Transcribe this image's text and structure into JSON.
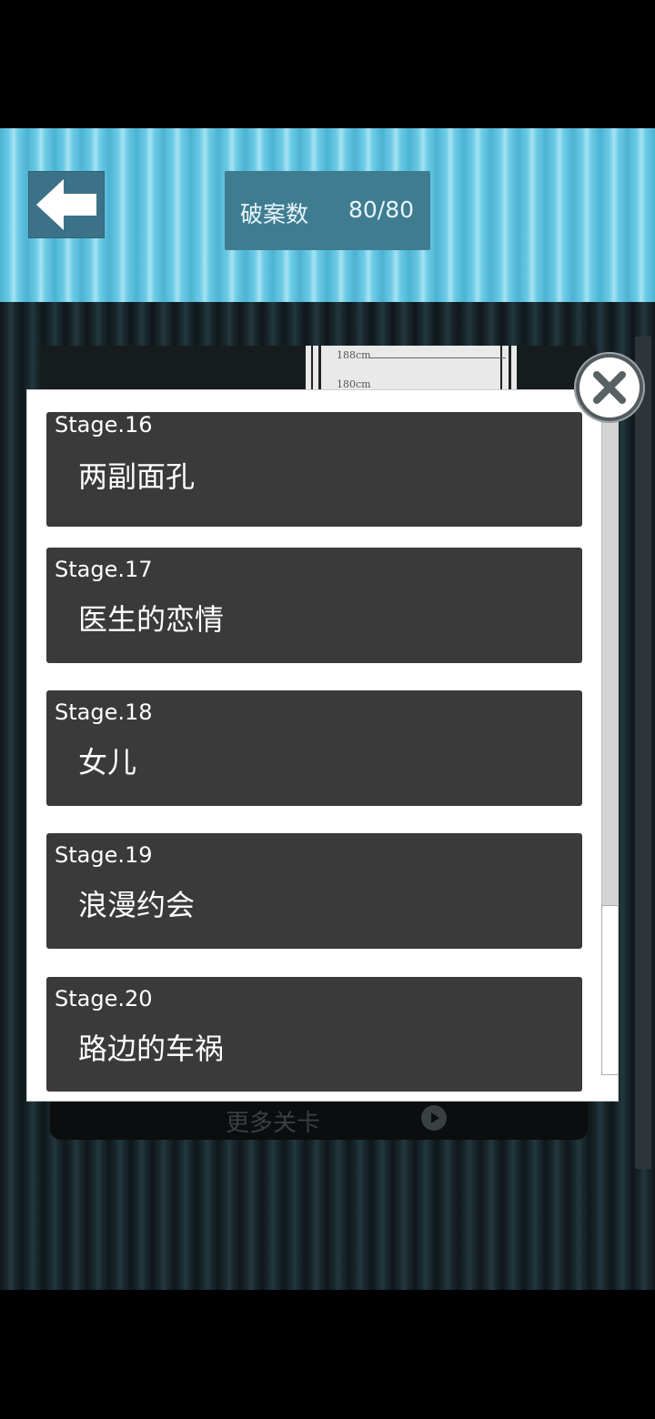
{
  "header": {
    "back_icon": "back-arrow-icon",
    "score_label": "破案数",
    "score_value": "80/80"
  },
  "background": {
    "more_levels_label": "更多关卡",
    "photo_mark_1": "188cm",
    "photo_mark_2": "180cm"
  },
  "dialog": {
    "close_icon": "close-icon",
    "stages": [
      {
        "number": "Stage.16",
        "name": "两副面孔"
      },
      {
        "number": "Stage.17",
        "name": "医生的恋情"
      },
      {
        "number": "Stage.18",
        "name": "女儿"
      },
      {
        "number": "Stage.19",
        "name": "浪漫约会"
      },
      {
        "number": "Stage.20",
        "name": "路边的车祸"
      }
    ]
  },
  "colors": {
    "header_blue": "#6ccbe6",
    "panel_blue": "#3f7c90",
    "card_dark": "#3a3a3a"
  }
}
